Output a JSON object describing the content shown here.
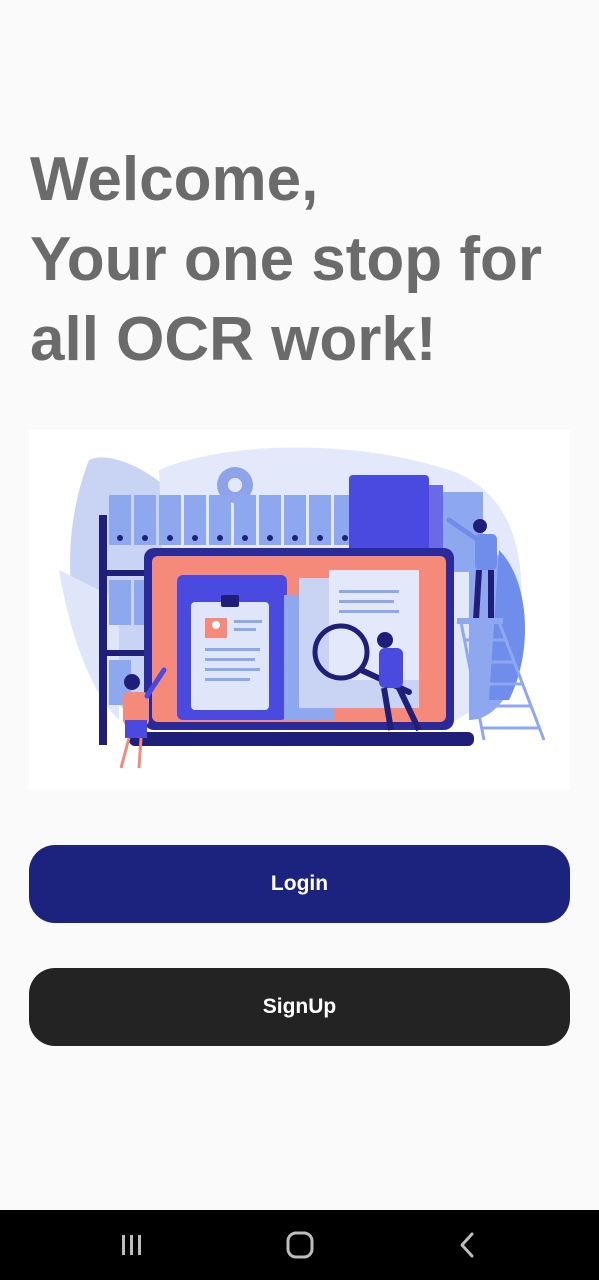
{
  "welcome": {
    "line1": "Welcome,",
    "line2": "Your one stop for",
    "line3": "all OCR work!"
  },
  "buttons": {
    "login_label": "Login",
    "signup_label": "SignUp"
  },
  "navbar": {
    "recents_icon": "recents-icon",
    "home_icon": "home-icon",
    "back_icon": "back-icon"
  },
  "colors": {
    "headline": "#6b6b6b",
    "login_button": "#1b237e",
    "signup_button": "#232323",
    "background": "#fafafa",
    "illustration_accent": "#4a4ae0",
    "illustration_coral": "#f58a7a"
  }
}
